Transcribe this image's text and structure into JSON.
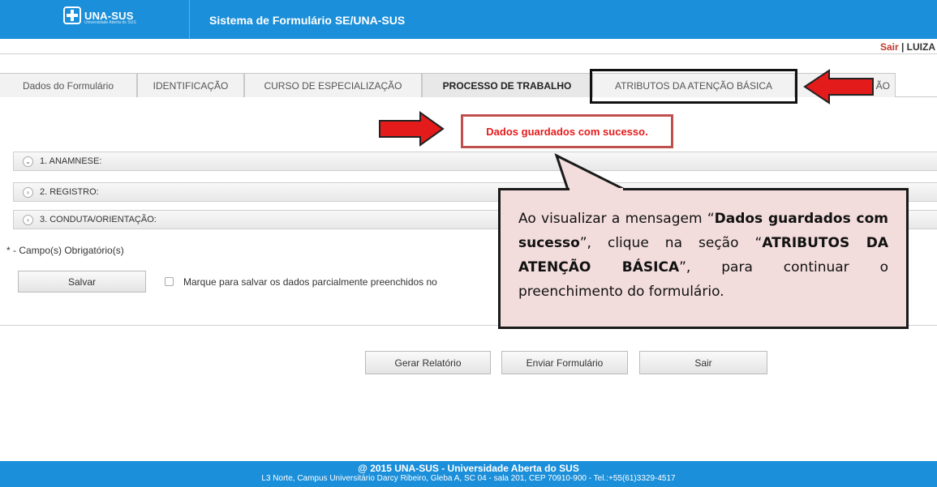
{
  "header": {
    "logo_text": "UNA-SUS",
    "logo_subtext": "Universidade Aberta do SUS",
    "system_title": "Sistema de Formulário SE/UNA-SUS",
    "brand_color": "#1b8fd9"
  },
  "userbar": {
    "logout_label": "Sair",
    "separator": "|",
    "user_name": "LUIZA"
  },
  "tabs": [
    {
      "label": "Dados do Formulário",
      "active": false
    },
    {
      "label": "IDENTIFICAÇÃO",
      "active": false
    },
    {
      "label": "CURSO DE ESPECIALIZAÇÃO",
      "active": false
    },
    {
      "label": "PROCESSO DE TRABALHO",
      "active": true
    },
    {
      "label": "ATRIBUTOS DA ATENÇÃO BÁSICA",
      "active": false
    },
    {
      "label": "ÃO",
      "active": false
    }
  ],
  "success_message": "Dados guardados com sucesso.",
  "sections": [
    {
      "label": "1. ANAMNESE:",
      "icon": "chevron-down-icon"
    },
    {
      "label": "2. REGISTRO:",
      "icon": "chevron-right-icon"
    },
    {
      "label": "3. CONDUTA/ORIENTAÇÃO:",
      "icon": "chevron-right-icon"
    }
  ],
  "form": {
    "required_note": "* - Campo(s) Obrigatório(s)",
    "save_label": "Salvar",
    "partial_save_label": "Marque para salvar os dados parcialmente preenchidos no"
  },
  "actions": {
    "report_label": "Gerar Relatório",
    "submit_label": "Enviar Formulário",
    "exit_label": "Sair"
  },
  "footer": {
    "line1": "@ 2015 UNA-SUS - Universidade Aberta do SUS",
    "line2": "L3 Norte, Campus Universitário Darcy Ribeiro, Gleba A, SC 04 - sala 201, CEP 70910-900 - Tel.:+55(61)3329-4517"
  },
  "annotation": {
    "t1": "Ao visualizar a mensagem “",
    "b1": "Dados guardados com sucesso",
    "t2": "”, clique na seção “",
    "b2": "ATRIBUTOS DA ATENÇÃO BÁSICA",
    "t3": "”, para continuar o preenchimento do formulário.",
    "arrow_color": "#e31b1b"
  }
}
